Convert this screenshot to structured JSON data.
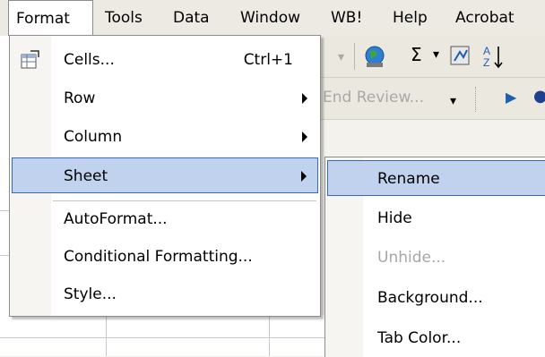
{
  "menubar": {
    "items": [
      {
        "label": "Format"
      },
      {
        "label": "Tools"
      },
      {
        "label": "Data"
      },
      {
        "label": "Window"
      },
      {
        "label": "WB!"
      },
      {
        "label": "Help"
      },
      {
        "label": "Acrobat"
      }
    ]
  },
  "toolbar": {
    "sigma": "Σ",
    "end_review": "End Review..."
  },
  "format_menu": {
    "items": [
      {
        "label": "Cells...",
        "shortcut": "Ctrl+1"
      },
      {
        "label": "Row"
      },
      {
        "label": "Column"
      },
      {
        "label": "Sheet"
      },
      {
        "label": "AutoFormat..."
      },
      {
        "label": "Conditional Formatting..."
      },
      {
        "label": "Style..."
      }
    ]
  },
  "sheet_submenu": {
    "items": [
      {
        "label": "Rename"
      },
      {
        "label": "Hide"
      },
      {
        "label": "Unhide..."
      },
      {
        "label": "Background..."
      },
      {
        "label": "Tab Color..."
      }
    ]
  },
  "colors": {
    "highlight": "#c1d2ee",
    "highlight_border": "#316ac5"
  }
}
